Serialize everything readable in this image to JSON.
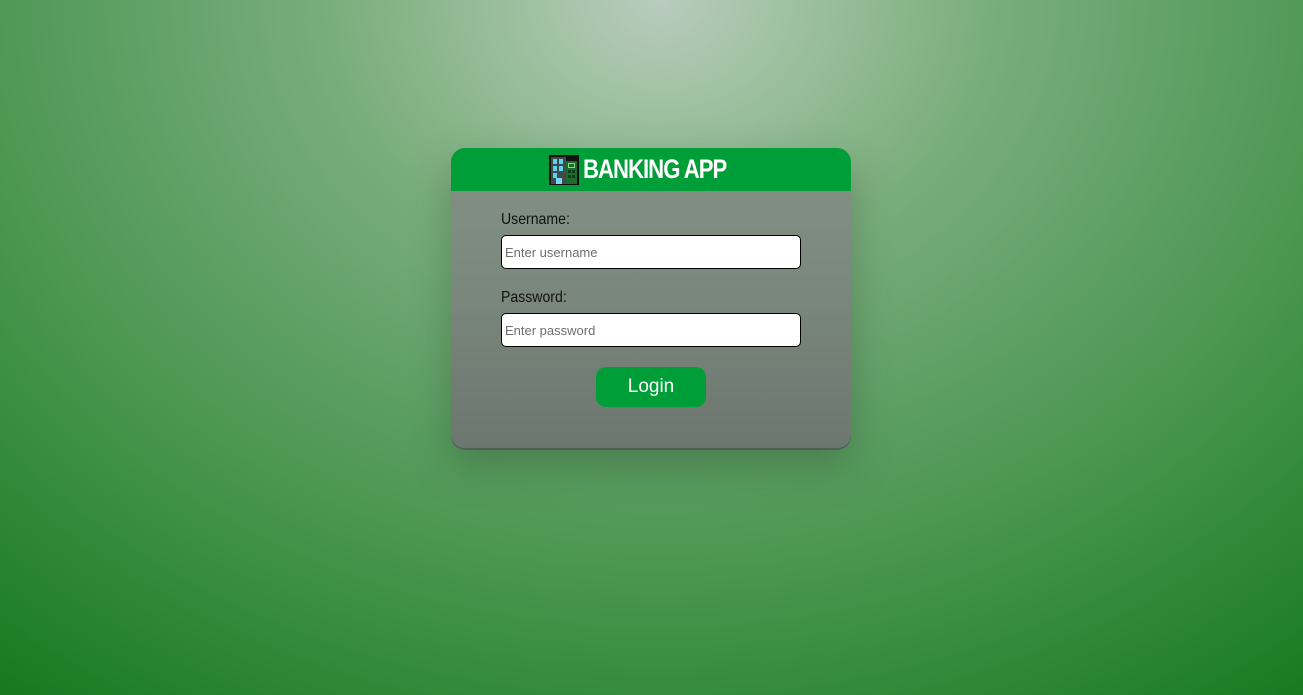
{
  "app": {
    "title": "BANKING APP",
    "icon": "bank-building-icon"
  },
  "login_form": {
    "username_label": "Username:",
    "username_placeholder": "Enter username",
    "username_value": "",
    "password_label": "Password:",
    "password_placeholder": "Enter password",
    "password_value": "",
    "submit_label": "Login"
  },
  "colors": {
    "accent": "#009e38",
    "background_light": "#b9cbbd",
    "background_dark": "#14761f",
    "card": "#7b887d"
  }
}
